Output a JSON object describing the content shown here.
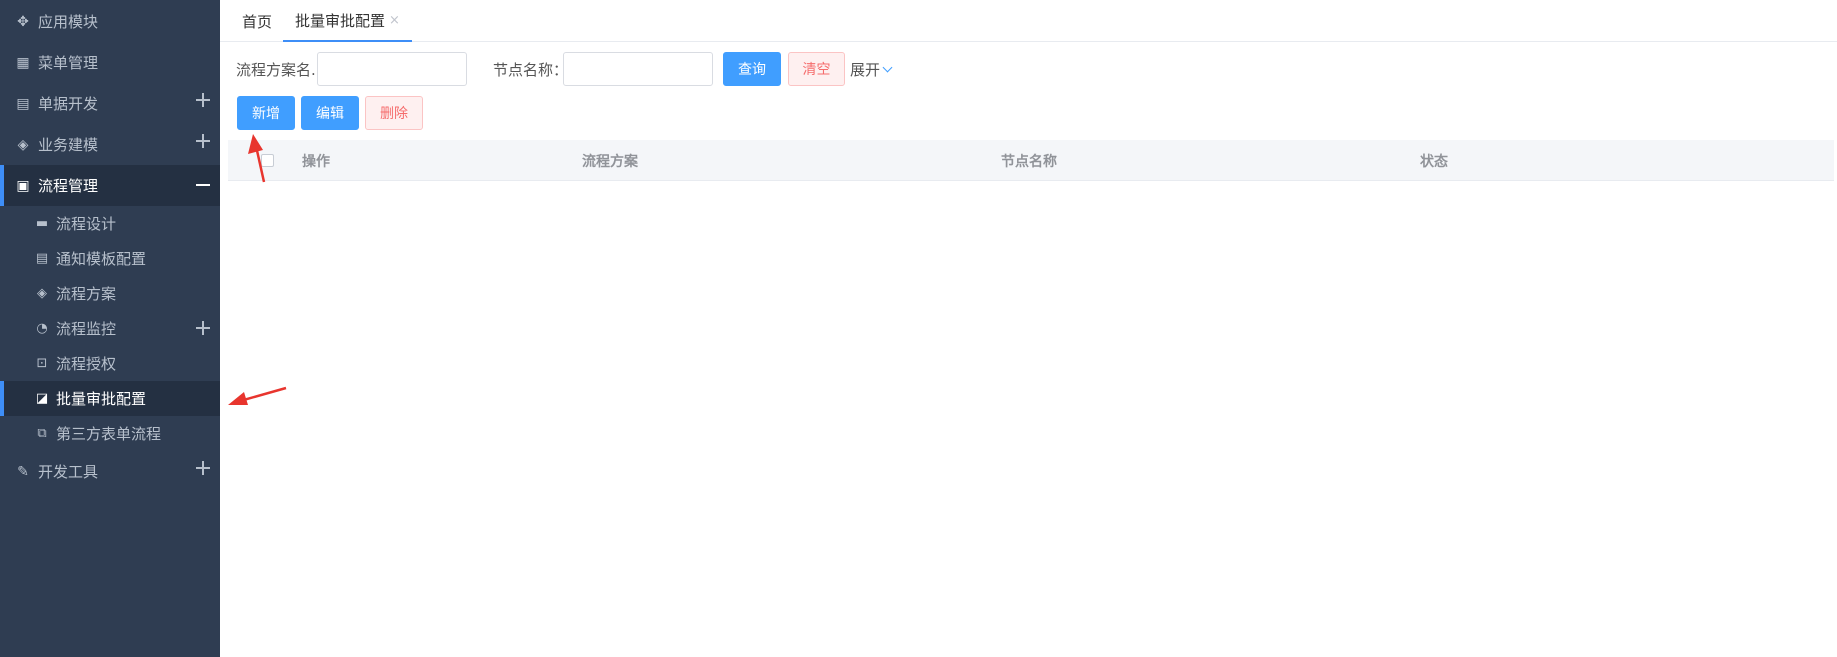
{
  "sidebar": {
    "items": [
      {
        "label": "应用模块",
        "icon": "module-icon"
      },
      {
        "label": "菜单管理",
        "icon": "grid-icon"
      },
      {
        "label": "单据开发",
        "icon": "clipboard-icon"
      },
      {
        "label": "业务建模",
        "icon": "cube-icon"
      },
      {
        "label": "流程管理",
        "icon": "flow-icon"
      },
      {
        "label": "开发工具",
        "icon": "wrench-icon"
      }
    ],
    "sub_items": [
      {
        "label": "流程设计",
        "icon": "file-icon"
      },
      {
        "label": "通知模板配置",
        "icon": "template-icon"
      },
      {
        "label": "流程方案",
        "icon": "cube-icon"
      },
      {
        "label": "流程监控",
        "icon": "monitor-icon"
      },
      {
        "label": "流程授权",
        "icon": "auth-icon"
      },
      {
        "label": "批量审批配置",
        "icon": "edit-icon"
      },
      {
        "label": "第三方表单流程",
        "icon": "sitemap-icon"
      }
    ]
  },
  "tabs": [
    {
      "label": "首页"
    },
    {
      "label": "批量审批配置",
      "close": "×"
    }
  ],
  "search": {
    "scheme_label": "流程方案名...",
    "node_label": "节点名称：",
    "query_label": "查询",
    "clear_label": "清空",
    "expand_label": "展开"
  },
  "toolbar": {
    "add_label": "新增",
    "edit_label": "编辑",
    "delete_label": "删除"
  },
  "table": {
    "columns": [
      "操作",
      "流程方案",
      "节点名称",
      "状态"
    ]
  },
  "colors": {
    "sidebar_bg": "#2f3d52",
    "accent": "#409eff",
    "danger": "#f56c6c",
    "arrow": "#e8352e"
  }
}
